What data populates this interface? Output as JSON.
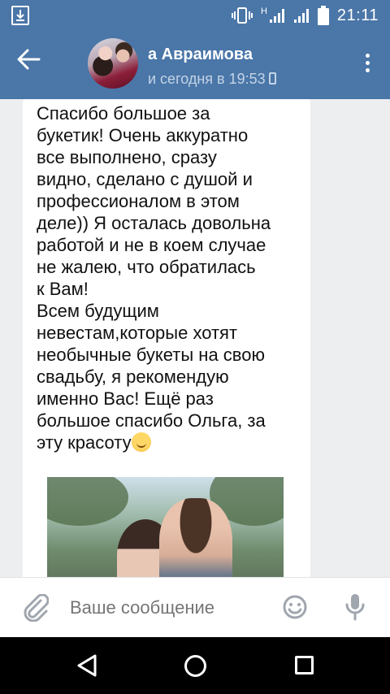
{
  "status_bar": {
    "time": "21:11",
    "network_label": "H",
    "icons": [
      "download-icon",
      "vibrate-icon",
      "signal-icon",
      "signal-icon",
      "battery-icon"
    ]
  },
  "header": {
    "contact_name": "а Авраимова",
    "last_seen": "и сегодня в 19:53",
    "icons": [
      "back-arrow-icon",
      "avatar",
      "mobile-phone-icon",
      "more-vertical-icon"
    ]
  },
  "message": {
    "text": "Спасибо большое за\nбукетик! Очень аккуратно\nвсе выполнено, сразу\nвидно, сделано с душой и\nпрофессионалом в этом\nделе)) Я осталась довольна\nработой и не в коем случае\nне жалею, что обратилась\nк Вам!\nВсем будущим\nневестам,которые хотят\nнеобычные букеты на свою\nсвадьбу, я рекомендую\nименно Вас! Ещё раз\nбольшое спасибо Ольга, за\nэту красоту",
    "emoji": "smiling-face-icon",
    "has_photo": true
  },
  "input_bar": {
    "placeholder": "Ваше сообщение",
    "icons": [
      "paperclip-icon",
      "emoji-icon",
      "microphone-icon"
    ]
  },
  "nav_bar": {
    "icons": [
      "nav-back-icon",
      "nav-home-icon",
      "nav-recent-icon"
    ]
  },
  "colors": {
    "header_bg": "#4a76a8",
    "chat_bg": "#edeef0",
    "bubble_bg": "#ffffff",
    "icon_gray": "#a0a6ae"
  }
}
